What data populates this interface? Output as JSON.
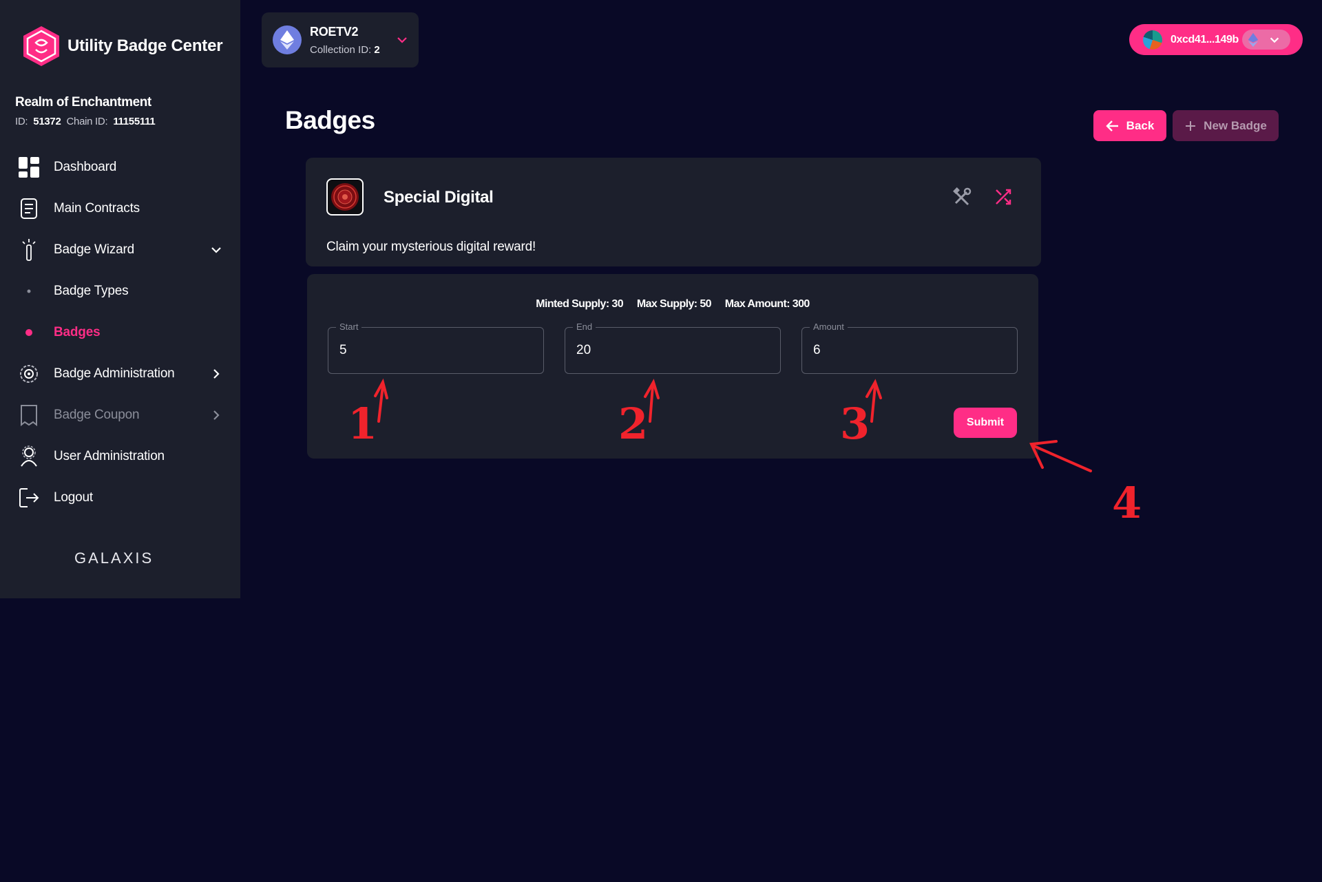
{
  "app": {
    "title": "Utility Badge Center",
    "footer_brand": "GALAXIS"
  },
  "project": {
    "name": "Realm of Enchantment",
    "id_label": "ID:",
    "id_value": "51372",
    "chain_label": "Chain ID:",
    "chain_value": "11155111"
  },
  "sidebar": {
    "items": [
      {
        "label": "Dashboard",
        "icon": "dashboard-grid-icon"
      },
      {
        "label": "Main Contracts",
        "icon": "document-icon"
      },
      {
        "label": "Badge Wizard",
        "icon": "magic-wand-icon",
        "expanded": true
      },
      {
        "label": "Badge Types",
        "icon": "bullet-dot-icon"
      },
      {
        "label": "Badges",
        "icon": "bullet-dot-icon",
        "active": true
      },
      {
        "label": "Badge Administration",
        "icon": "gear-cluster-icon"
      },
      {
        "label": "Badge Coupon",
        "icon": "coupon-icon",
        "disabled": true
      },
      {
        "label": "User Administration",
        "icon": "user-admin-icon"
      },
      {
        "label": "Logout",
        "icon": "logout-icon"
      }
    ]
  },
  "collection": {
    "name": "ROETV2",
    "id_label": "Collection ID:",
    "id_value": "2"
  },
  "wallet": {
    "address": "0xcd41...149b",
    "network_icon": "ethereum-icon"
  },
  "page": {
    "title": "Badges",
    "back_label": "Back",
    "new_badge_label": "New Badge"
  },
  "badge": {
    "name": "Special Digital",
    "description": "Claim your mysterious digital reward!"
  },
  "form": {
    "minted_supply": "Minted Supply: 30",
    "max_supply": "Max Supply: 50",
    "max_amount": "Max Amount: 300",
    "start_label": "Start",
    "start_value": "5",
    "end_label": "End",
    "end_value": "20",
    "amount_label": "Amount",
    "amount_value": "6",
    "submit_label": "Submit"
  },
  "annotations": [
    "1",
    "2",
    "3",
    "4"
  ],
  "colors": {
    "background": "#090926",
    "panel": "#1c1f2c",
    "accent": "#ff2d86",
    "annotation": "#f0232c"
  }
}
